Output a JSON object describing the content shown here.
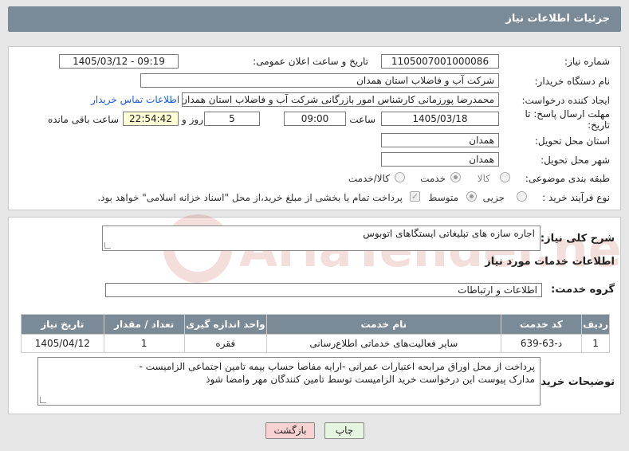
{
  "header": {
    "title": "جزئیات اطلاعات نیاز"
  },
  "form": {
    "need_number": {
      "label": "شماره نیاز:",
      "value": "1105007001000086"
    },
    "announce_datetime": {
      "label": "تاریخ و ساعت اعلان عمومی:",
      "value": "1405/03/12 - 09:19"
    },
    "buyer_org": {
      "label": "نام دستگاه خریدار:",
      "value": "شرکت آب و فاضلاب استان همدان"
    },
    "requester": {
      "label": "ایجاد کننده درخواست:",
      "value": "محمدرضا پورزمانی کارشناس امور بازرگانی شرکت آب و فاضلاب استان همدان"
    },
    "buyer_contact_link": "اطلاعات تماس خریدار",
    "deadline": {
      "label": "مهلت ارسال پاسخ: تا تاریخ:",
      "date": "1405/03/18",
      "time_label": "ساعت",
      "time": "09:00",
      "days": "5",
      "days_label": "روز و",
      "remaining": "22:54:42",
      "remaining_label": "ساعت باقی مانده"
    },
    "delivery_province": {
      "label": "استان محل تحویل:",
      "value": "همدان"
    },
    "delivery_city": {
      "label": "شهر محل تحویل:",
      "value": "همدان"
    },
    "category": {
      "label": "طبقه بندی موضوعی:",
      "options": [
        "کالا",
        "خدمت",
        "کالا/خدمت"
      ]
    },
    "purchase_type": {
      "label": "نوع فرآیند خرید :",
      "options": [
        "جزیی",
        "متوسط"
      ],
      "note": "پرداخت تمام یا بخشی از مبلغ خرید،از محل \"اسناد خزانه اسلامی\" خواهد بود."
    }
  },
  "general_description": {
    "label": "شرح کلی نیاز:",
    "value": "اجاره سازه های تبلیغاتی ایستگاهای اتوبوس"
  },
  "services_section": {
    "title": "اطلاعات خدمات مورد نیاز",
    "group_label": "گروه خدمت:",
    "group_value": "اطلاعات و ارتباطات"
  },
  "table": {
    "headers": [
      "ردیف",
      "کد خدمت",
      "نام خدمت",
      "واحد اندازه گیری",
      "تعداد / مقدار",
      "تاریخ نیاز"
    ],
    "rows": [
      [
        "1",
        "د-63-639",
        "سایر فعالیت‌های خدماتی اطلاع‌رسانی",
        "فقره",
        "1",
        "1405/04/12"
      ]
    ]
  },
  "buyer_notes": {
    "label": "توضیحات خریدار:",
    "line1": "پرداخت از محل اوراق مرابحه اعتبارات عمرانی -ارایه مفاصا حساب بیمه تامین اجتماعی الزامیست -",
    "line2": "مدارک پیوست این درخواست خرید الزامیست توسط تامین کنندگان مهر وامضا شوذ"
  },
  "buttons": {
    "print": "چاپ",
    "back": "بازگشت"
  },
  "watermark_text": "AriaTender.net",
  "colors": {
    "header": "#7a8a96",
    "link": "#1a5ad6",
    "back_button": "#f6d2d2",
    "print_button": "#e6f5e0"
  }
}
